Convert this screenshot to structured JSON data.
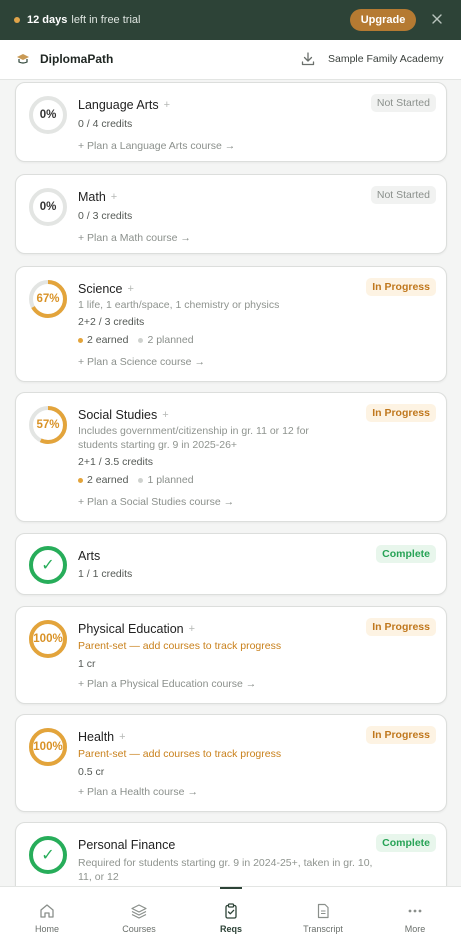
{
  "trial": {
    "days": "12 days",
    "rest": "left in free trial",
    "upgrade_label": "Upgrade"
  },
  "header": {
    "app_name": "DiplomaPath",
    "org_name": "Sample Family Academy"
  },
  "colors": {
    "brand": "#2d4337",
    "accent": "#b57a32",
    "in_progress": "#e3a43b",
    "complete": "#27ad5a",
    "not_started": "#e3e5e3"
  },
  "cards": [
    {
      "title": "Language Arts",
      "ring": "0%",
      "progress": 0,
      "status": "Not Started",
      "credits": "0 / 4 credits",
      "plan": "+  Plan a Language Arts course →"
    },
    {
      "title": "Math",
      "ring": "0%",
      "progress": 0,
      "status": "Not Started",
      "credits": "0 / 3 credits",
      "plan": "+  Plan a Math course →"
    },
    {
      "title": "Science",
      "ring": "67%",
      "progress": 0.67,
      "status": "In Progress",
      "note": "1 life, 1 earth/space, 1 chemistry or physics",
      "credits": "2+2 / 3 credits",
      "earned": "2 earned",
      "planned": "2 planned",
      "plan": "+  Plan a Science course →"
    },
    {
      "title": "Social Studies",
      "ring": "57%",
      "progress": 0.57,
      "status": "In Progress",
      "note": "Includes government/citizenship in gr. 11 or 12 for students starting gr. 9 in 2025-26+",
      "credits": "2+1 / 3.5 credits",
      "earned": "2 earned",
      "planned": "1 planned",
      "plan": "+  Plan a Social Studies course →"
    },
    {
      "title": "Arts",
      "ring": "✓",
      "progress": 1,
      "status": "Complete",
      "credits": "1 / 1 credits"
    },
    {
      "title": "Physical Education",
      "ring": "100%",
      "progress": 1,
      "status": "In Progress",
      "note": "Parent-set — add courses to track progress",
      "credits": "1 cr",
      "plan": "+  Plan a Physical Education course →"
    },
    {
      "title": "Health",
      "ring": "100%",
      "progress": 1,
      "status": "In Progress",
      "note": "Parent-set — add courses to track progress",
      "credits": "0.5 cr",
      "plan": "+  Plan a Health course →"
    },
    {
      "title": "Personal Finance",
      "ring": "✓",
      "progress": 1,
      "status": "Complete",
      "note": "Required for students starting gr. 9 in 2024-25+, taken in gr. 10, 11, or 12"
    }
  ],
  "plus_mark": "+",
  "nav": [
    {
      "label": "Home",
      "icon": "home-icon"
    },
    {
      "label": "Courses",
      "icon": "layers-icon"
    },
    {
      "label": "Reqs",
      "icon": "clipboard-check-icon",
      "active": true
    },
    {
      "label": "Transcript",
      "icon": "document-icon"
    },
    {
      "label": "More",
      "icon": "more-dots-icon"
    }
  ]
}
